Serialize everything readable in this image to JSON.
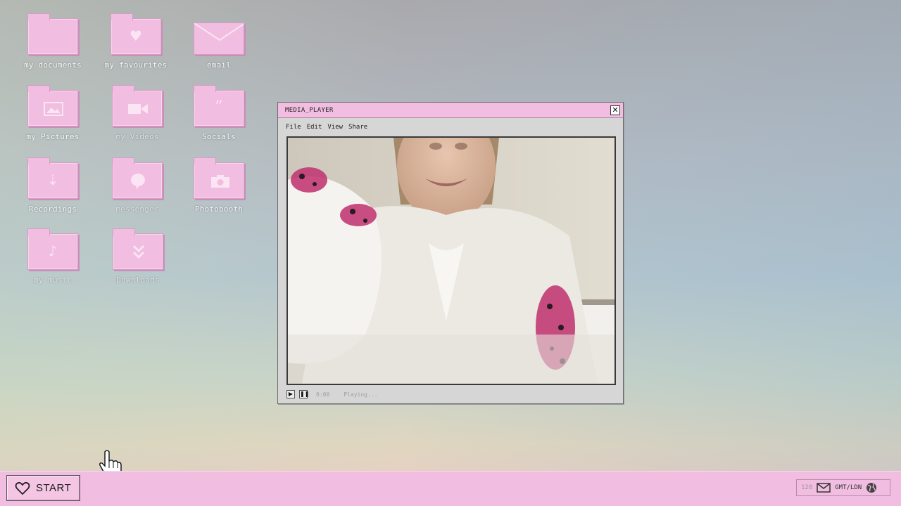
{
  "desktop": {
    "icons": [
      {
        "label": "my documents",
        "icon": "folder-icon"
      },
      {
        "label": "my favourites",
        "icon": "folder-heart-icon"
      },
      {
        "label": "email",
        "icon": "envelope-icon"
      },
      {
        "label": "my Pictures",
        "icon": "folder-image-icon"
      },
      {
        "label": "my Videos",
        "icon": "folder-video-icon"
      },
      {
        "label": "Socials",
        "icon": "folder-quote-icon"
      },
      {
        "label": "Recordings",
        "icon": "folder-download-icon"
      },
      {
        "label": "messenger",
        "icon": "folder-chat-icon"
      },
      {
        "label": "Photobooth",
        "icon": "folder-camera-icon"
      },
      {
        "label": "my music",
        "icon": "folder-music-icon"
      },
      {
        "label": "Downloads",
        "icon": "folder-chevrons-icon"
      }
    ]
  },
  "media_player": {
    "title": "MEDIA_PLAYER",
    "close_glyph": "✕",
    "menu": [
      "File",
      "Edit",
      "View",
      "Share"
    ],
    "time": "0:00",
    "status": "Playing..."
  },
  "taskbar": {
    "start_label": "START",
    "tray": {
      "count": "120",
      "timezone": "GMT/LDN"
    }
  },
  "colors": {
    "accent_pink": "#f1bde0",
    "window_gray": "#d6d6d6"
  }
}
